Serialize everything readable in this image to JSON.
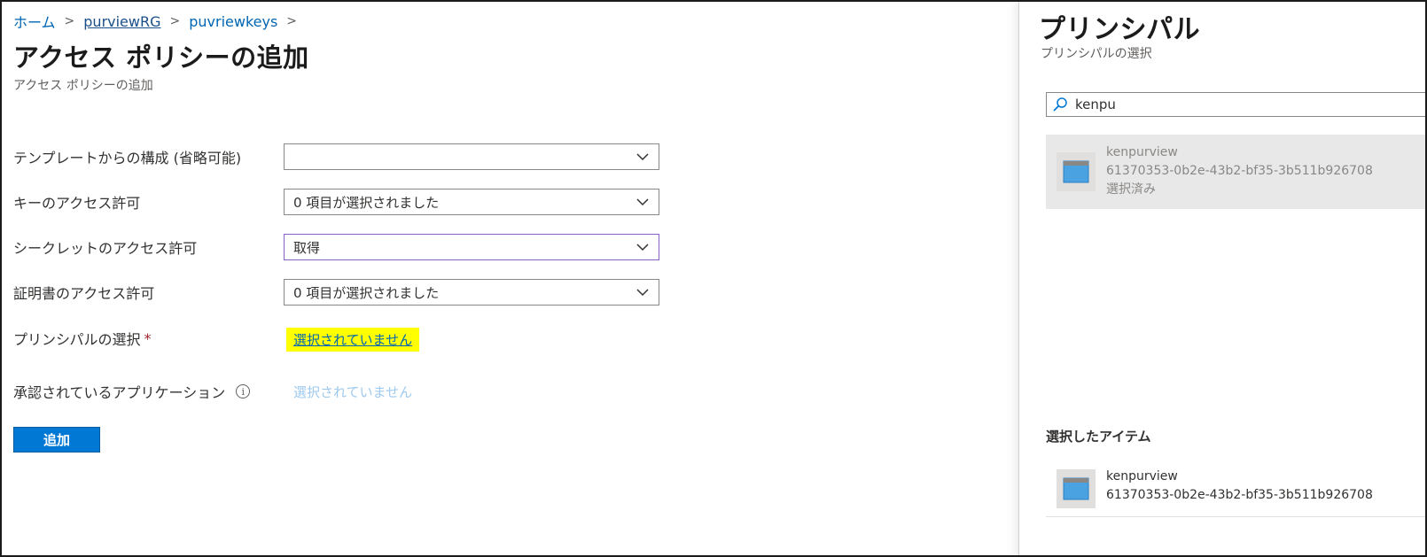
{
  "breadcrumb": {
    "home": "ホーム",
    "resource_group": "purviewRG",
    "key_vault": "puvriewkeys"
  },
  "page": {
    "title": "アクセス ポリシーの追加",
    "subtitle": "アクセス ポリシーの追加"
  },
  "form": {
    "template": {
      "label": "テンプレートからの構成 (省略可能)",
      "value": ""
    },
    "key_permissions": {
      "label": "キーのアクセス許可",
      "value": "0 項目が選択されました"
    },
    "secret_permissions": {
      "label": "シークレットのアクセス許可",
      "value": "取得"
    },
    "certificate_permissions": {
      "label": "証明書のアクセス許可",
      "value": "0 項目が選択されました"
    },
    "principal": {
      "label": "プリンシパルの選択",
      "required_mark": "*",
      "value": "選択されていません"
    },
    "authorized_app": {
      "label": "承認されているアプリケーション",
      "info_icon": "info-icon",
      "value": "選択されていません"
    },
    "add_button": "追加"
  },
  "principal_panel": {
    "title": "プリンシパル",
    "subtitle": "プリンシパルの選択",
    "search": {
      "value": "kenpu",
      "icon": "search-icon"
    },
    "results": [
      {
        "name": "kenpurview",
        "id": "61370353-0b2e-43b2-bf35-3b511b926708",
        "status": "選択済み"
      }
    ],
    "selected_heading": "選択したアイテム",
    "selected_items": [
      {
        "name": "kenpurview",
        "id": "61370353-0b2e-43b2-bf35-3b511b926708"
      }
    ]
  },
  "colors": {
    "accent": "#0078d4",
    "link": "#0065b3",
    "highlight": "#ffff00",
    "focus_border": "#8661c5"
  }
}
